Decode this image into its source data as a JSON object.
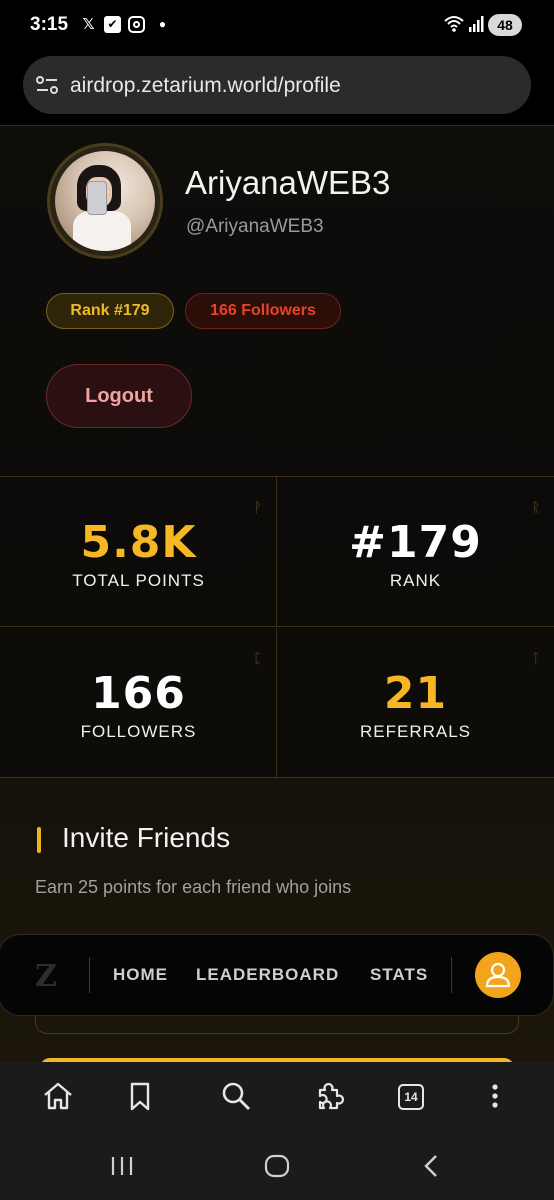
{
  "status_bar": {
    "time": "3:15",
    "battery": "48",
    "icons": [
      "x-icon",
      "checkbox-icon",
      "instagram-icon",
      "dot-icon",
      "wifi-icon",
      "signal-icon"
    ]
  },
  "browser": {
    "url": "airdrop.zetarium.world/profile",
    "tab_count": "14"
  },
  "profile": {
    "display_name": "AriyanaWEB3",
    "handle": "@AriyanaWEB3",
    "rank_badge": "Rank #179",
    "followers_badge": "166 Followers",
    "logout_label": "Logout"
  },
  "stats": [
    {
      "value": "5.8K",
      "label": "TOTAL POINTS",
      "color": "#f5b824"
    },
    {
      "value": "#179",
      "label": "RANK",
      "color": "#ffffff"
    },
    {
      "value": "166",
      "label": "FOLLOWERS",
      "color": "#ffffff"
    },
    {
      "value": "21",
      "label": "REFERRALS",
      "color": "#f5b824"
    }
  ],
  "invite": {
    "title": "Invite Friends",
    "subtitle": "Earn 25 points for each friend who joins"
  },
  "app_nav": {
    "logo": "Z",
    "links": [
      "HOME",
      "LEADERBOARD",
      "STATS"
    ]
  },
  "colors": {
    "accent_gold": "#f5b824",
    "danger_red": "#e6432b"
  }
}
